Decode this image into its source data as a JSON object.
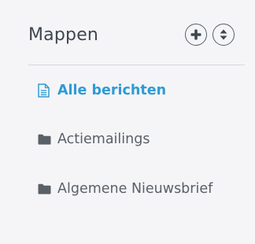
{
  "panel": {
    "title": "Mappen",
    "buttons": {
      "add_icon": "plus-circle-icon",
      "sort_icon": "sort-circle-icon"
    },
    "items": [
      {
        "label": "Alle berichten",
        "icon": "document-icon",
        "active": true
      },
      {
        "label": "Actiemailings",
        "icon": "folder-icon",
        "active": false
      },
      {
        "label": "Algemene Nieuwsbrief",
        "icon": "folder-icon",
        "active": false
      }
    ]
  },
  "colors": {
    "active": "#2e9bd6",
    "text": "#5a6068",
    "title": "#3f4650",
    "background": "#f5f5f7"
  }
}
